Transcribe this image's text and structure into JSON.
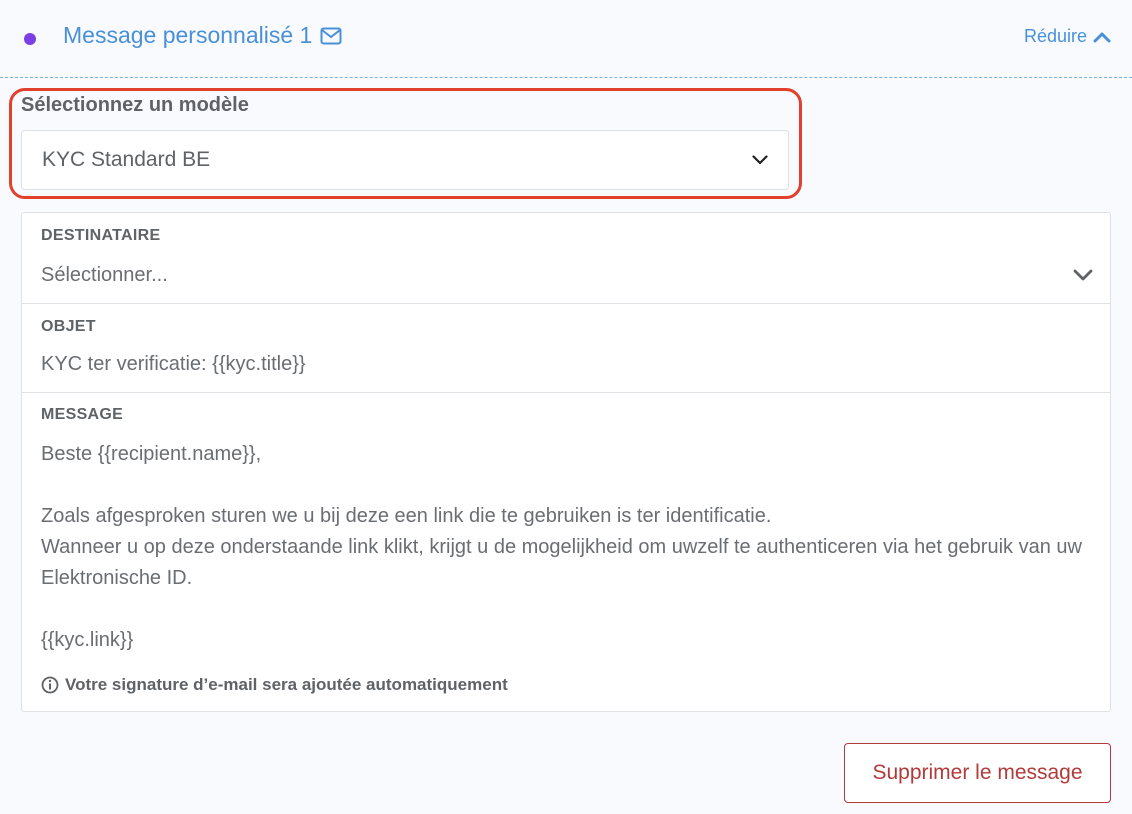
{
  "header": {
    "title": "Message personnalisé 1",
    "collapse_label": "Réduire",
    "accent_color": "#4a90d9",
    "dot_color": "#7b3fe4"
  },
  "template": {
    "label": "Sélectionnez un modèle",
    "selected": "KYC Standard BE",
    "highlight_color": "#e0402c"
  },
  "recipient": {
    "label": "DESTINATAIRE",
    "placeholder": "Sélectionner..."
  },
  "subject": {
    "label": "OBJET",
    "value": "KYC ter verificatie: {{kyc.title}}"
  },
  "message": {
    "label": "MESSAGE",
    "body": "Beste {{recipient.name}},\n\nZoals afgesproken sturen we u bij deze een link die te gebruiken is ter identificatie.\nWanneer u op deze onderstaande link klikt, krijgt u de mogelijkheid om uwzelf te authenticeren via het gebruik van uw Elektronische ID.\n\n{{kyc.link}}",
    "signature_note": "Votre signature d’e-mail sera ajoutée automatiquement"
  },
  "actions": {
    "delete_label": "Supprimer le message",
    "delete_color": "#b33a3a"
  },
  "icons": {
    "title_icon": "envelope-icon",
    "collapse_icon": "chevron-up-icon",
    "select_icon": "chevron-down-icon",
    "note_icon": "info-circle-icon"
  }
}
